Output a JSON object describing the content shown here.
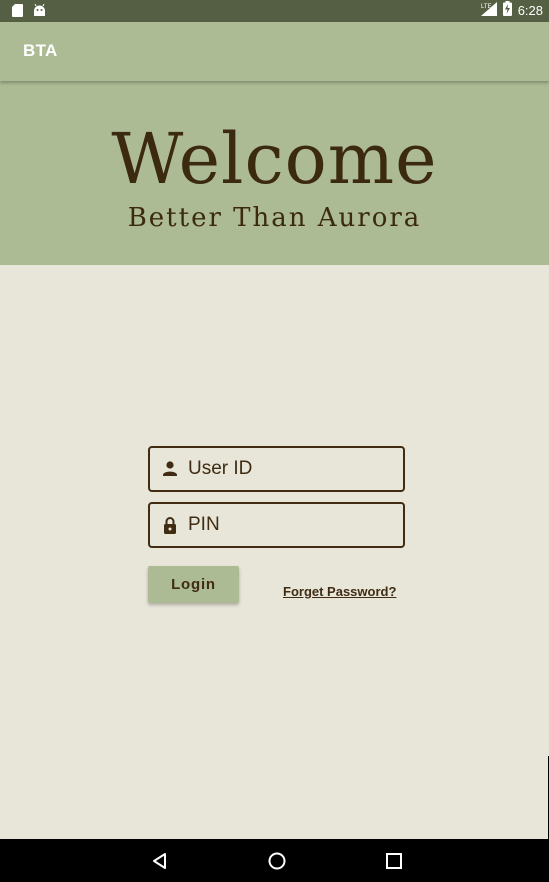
{
  "status_bar": {
    "time": "6:28",
    "network": "LTE",
    "icons": [
      "sd-card-icon",
      "android-icon",
      "signal-icon",
      "battery-charging-icon"
    ]
  },
  "app_bar": {
    "title": "BTA"
  },
  "header": {
    "welcome": "Welcome",
    "subtitle": "Better Than Aurora"
  },
  "form": {
    "user_id_placeholder": "User ID",
    "pin_placeholder": "PIN",
    "login_label": "Login",
    "forget_password_label": "Forget Password?"
  },
  "nav_bar": {
    "buttons": [
      "back-icon",
      "home-icon",
      "recents-icon"
    ]
  },
  "colors": {
    "status_bar": "#555f43",
    "primary": "#adbb95",
    "background": "#e8e5d9",
    "text_dark": "#3f2c13"
  }
}
